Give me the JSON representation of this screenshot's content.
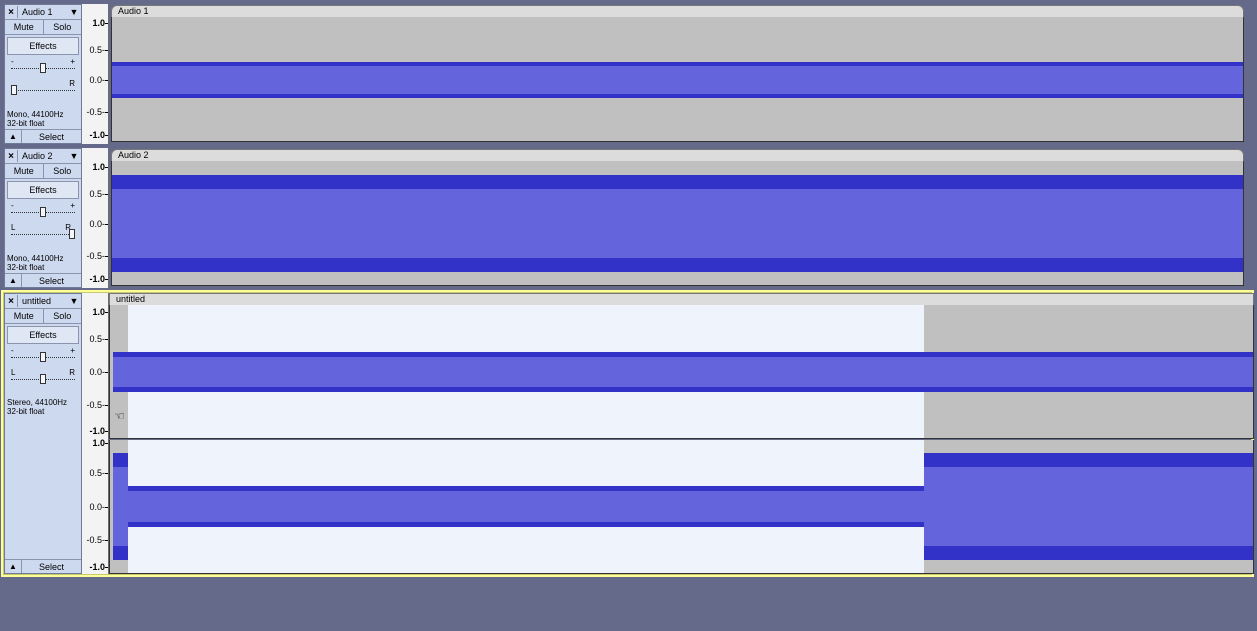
{
  "tracks": [
    {
      "name": "Audio 1",
      "title": "Audio 1",
      "mute_label": "Mute",
      "solo_label": "Solo",
      "effects_label": "Effects",
      "gain_minus": "-",
      "gain_plus": "+",
      "pan_left": "",
      "pan_right": "R",
      "info_line1": "Mono, 44100Hz",
      "info_line2": "32-bit float",
      "select_label": "Select",
      "gain": 0.5,
      "pan": 0.0,
      "ruler": [
        "1.0",
        "0.5-",
        "0.0-",
        "-0.5-",
        "-1.0"
      ]
    },
    {
      "name": "Audio 2",
      "title": "Audio 2",
      "mute_label": "Mute",
      "solo_label": "Solo",
      "effects_label": "Effects",
      "gain_minus": "-",
      "gain_plus": "+",
      "pan_left": "L",
      "pan_right": "R",
      "info_line1": "Mono, 44100Hz",
      "info_line2": "32-bit float",
      "select_label": "Select",
      "gain": 0.5,
      "pan": 1.0,
      "ruler": [
        "1.0",
        "0.5-",
        "0.0-",
        "-0.5-",
        "-1.0"
      ]
    },
    {
      "name": "untitled",
      "title": "untitled",
      "mute_label": "Mute",
      "solo_label": "Solo",
      "effects_label": "Effects",
      "gain_minus": "-",
      "gain_plus": "+",
      "pan_left": "L",
      "pan_right": "R",
      "info_line1": "Stereo, 44100Hz",
      "info_line2": "32-bit float",
      "select_label": "Select",
      "gain": 0.5,
      "pan": 0.5,
      "ruler_top": [
        "1.0",
        "0.5-",
        "0.0-",
        "-0.5-",
        "-1.0"
      ],
      "ruler_bottom": [
        "1.0",
        "0.5-",
        "0.0-",
        "-0.5-",
        "-1.0"
      ]
    }
  ],
  "colors": {
    "background": "#666a8a",
    "waveform": "#6464dc",
    "waveform_edge": "#3232c8",
    "selection": "#eef3fc",
    "focus_outline": "#ffff99",
    "control_panel": "#cdd9ef"
  },
  "icons": {
    "close": "×",
    "menu": "▼",
    "collapse": "▲",
    "cursor": "pointing-hand-icon"
  }
}
